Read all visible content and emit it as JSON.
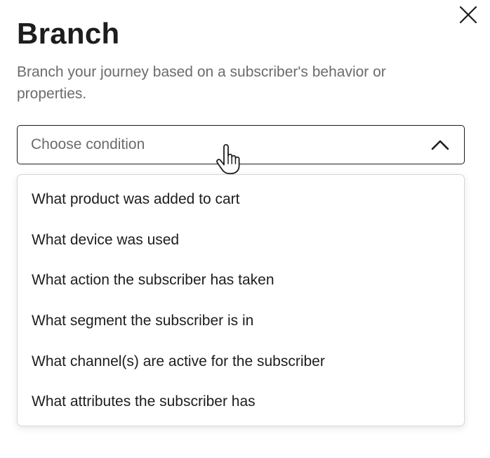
{
  "panel": {
    "title": "Branch",
    "description": "Branch your journey based on a subscriber's behavior or properties."
  },
  "close_button": {
    "icon": "close-icon"
  },
  "condition_select": {
    "placeholder": "Choose condition",
    "expanded": true,
    "icon": "chevron-up-icon",
    "options": [
      "What product was added to cart",
      "What device was used",
      "What action the subscriber has taken",
      "What segment the subscriber is in",
      "What channel(s) are active for the subscriber",
      "What attributes the subscriber has"
    ]
  },
  "cursor": {
    "icon": "hand-pointer-icon"
  }
}
